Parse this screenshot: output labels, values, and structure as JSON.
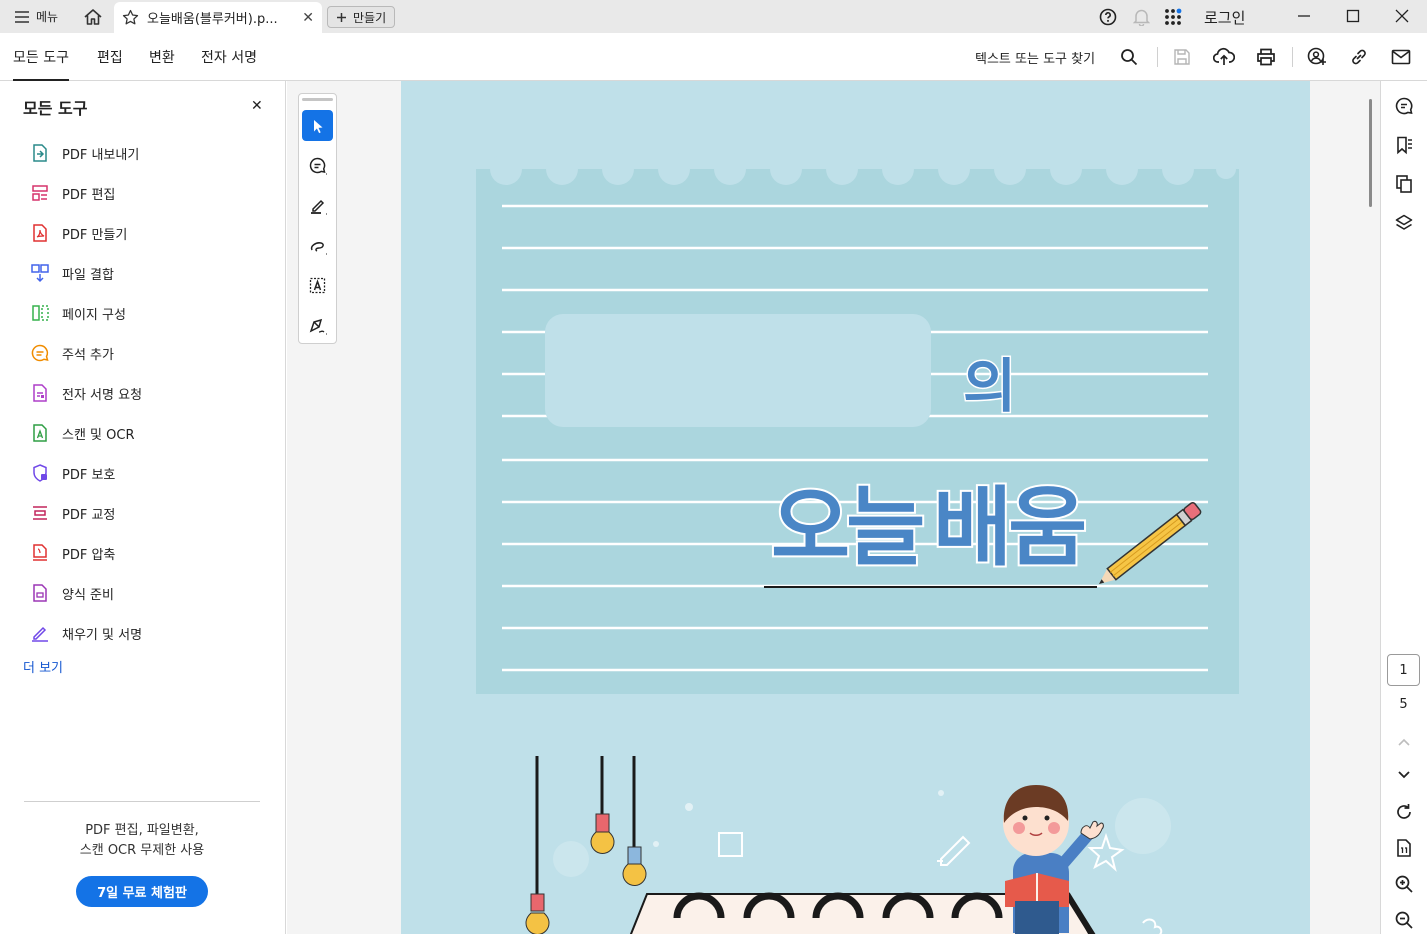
{
  "titlebar": {
    "menu_label": "메뉴",
    "tab_title": "오늘배움(블루커버).p...",
    "new_button_label": "만들기",
    "login_label": "로그인",
    "icons": [
      "menu-icon",
      "home-icon",
      "star-icon",
      "close-icon",
      "plus-icon",
      "help-icon",
      "bell-icon",
      "apps-icon",
      "minimize-icon",
      "maximize-icon",
      "window-close-icon"
    ]
  },
  "menubar": {
    "items": [
      {
        "label": "모든 도구",
        "active": true
      },
      {
        "label": "편집",
        "active": false
      },
      {
        "label": "변환",
        "active": false
      },
      {
        "label": "전자 서명",
        "active": false
      }
    ],
    "search_label": "텍스트 또는 도구 찾기",
    "icons": [
      "search-icon",
      "save-icon",
      "upload-cloud-icon",
      "print-icon",
      "share-user-icon",
      "link-icon",
      "mail-icon"
    ]
  },
  "left_panel": {
    "title": "모든 도구",
    "tools": [
      {
        "label": "PDF 내보내기",
        "icon": "export-pdf-icon",
        "color": "#2a8a8a"
      },
      {
        "label": "PDF 편집",
        "icon": "edit-pdf-icon",
        "color": "#d6336c"
      },
      {
        "label": "PDF 만들기",
        "icon": "create-pdf-icon",
        "color": "#e03131"
      },
      {
        "label": "파일 결합",
        "icon": "combine-files-icon",
        "color": "#4263eb"
      },
      {
        "label": "페이지 구성",
        "icon": "organize-pages-icon",
        "color": "#37b24d"
      },
      {
        "label": "주석 추가",
        "icon": "comment-icon",
        "color": "#f08c00"
      },
      {
        "label": "전자 서명 요청",
        "icon": "request-signature-icon",
        "color": "#ae3ec9"
      },
      {
        "label": "스캔 및 OCR",
        "icon": "scan-ocr-icon",
        "color": "#2f9e44"
      },
      {
        "label": "PDF 보호",
        "icon": "protect-pdf-icon",
        "color": "#7048e8"
      },
      {
        "label": "PDF 교정",
        "icon": "redact-pdf-icon",
        "color": "#c2255c"
      },
      {
        "label": "PDF 압축",
        "icon": "compress-pdf-icon",
        "color": "#e03131"
      },
      {
        "label": "양식 준비",
        "icon": "prepare-form-icon",
        "color": "#9c36b5"
      },
      {
        "label": "채우기 및 서명",
        "icon": "fill-sign-icon",
        "color": "#7048e8"
      }
    ],
    "more_label": "더 보기",
    "promo_line1": "PDF 편집, 파일변환,",
    "promo_line2": "스캔 OCR 무제한 사용",
    "trial_button": "7일 무료 체험판"
  },
  "quick_tools": [
    "select-pointer-icon",
    "add-comment-icon",
    "highlight-pen-icon",
    "draw-freehand-icon",
    "text-select-icon",
    "sign-pen-icon"
  ],
  "document": {
    "word_of": "의",
    "word_today": "오늘",
    "word_learning": "배움",
    "page_color": "#bfe0e9",
    "notebook_color": "#abd6de",
    "letter_color": "#4a86c6"
  },
  "right_rail": {
    "icons": [
      "comment-panel-icon",
      "bookmark-icon",
      "pages-icon",
      "layers-icon",
      "chevron-up-icon",
      "chevron-down-icon",
      "rotate-icon",
      "page-fit-icon",
      "zoom-in-icon",
      "zoom-out-icon"
    ],
    "current_page": "1",
    "total_pages": "5"
  }
}
